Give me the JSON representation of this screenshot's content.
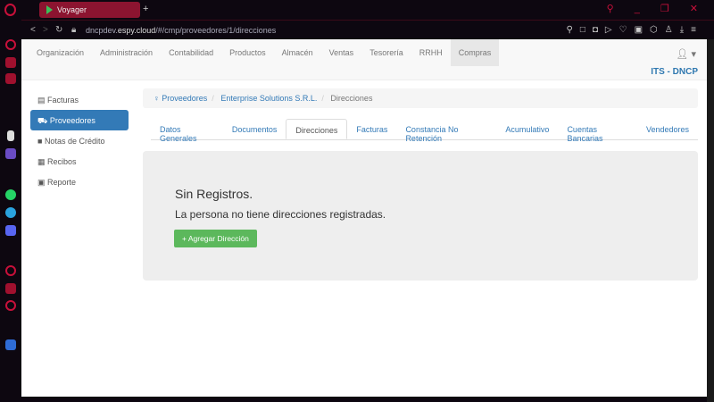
{
  "browser": {
    "tab_title": "Voyager",
    "url_prefix": "dncpdev.",
    "url_domain": "espy.cloud",
    "url_path": "/#/cmp/proveedores/1/direcciones"
  },
  "topnav": {
    "items": [
      "Organización",
      "Administración",
      "Contabilidad",
      "Productos",
      "Almacén",
      "Ventas",
      "Tesorería",
      "RRHH",
      "Compras"
    ],
    "active": "Compras",
    "org": "ITS - DNCP"
  },
  "sidebar": {
    "items": [
      "Facturas",
      "Proveedores",
      "Notas de Crédito",
      "Recibos",
      "Reporte"
    ],
    "active": "Proveedores"
  },
  "breadcrumb": [
    "Proveedores",
    "Enterprise Solutions S.R.L.",
    "Direcciones"
  ],
  "tabs": {
    "items": [
      "Datos Generales",
      "Documentos",
      "Direcciones",
      "Facturas",
      "Constancia No Retención",
      "Acumulativo",
      "Cuentas Bancarias",
      "Vendedores"
    ],
    "active": "Direcciones"
  },
  "empty": {
    "title": "Sin Registros.",
    "message": "La persona no tiene direcciones registradas.",
    "button": "+ Agregar Dirección"
  },
  "colors": {
    "primary": "#337ab7",
    "success": "#5cb85c",
    "browser_accent": "#c8103a"
  }
}
